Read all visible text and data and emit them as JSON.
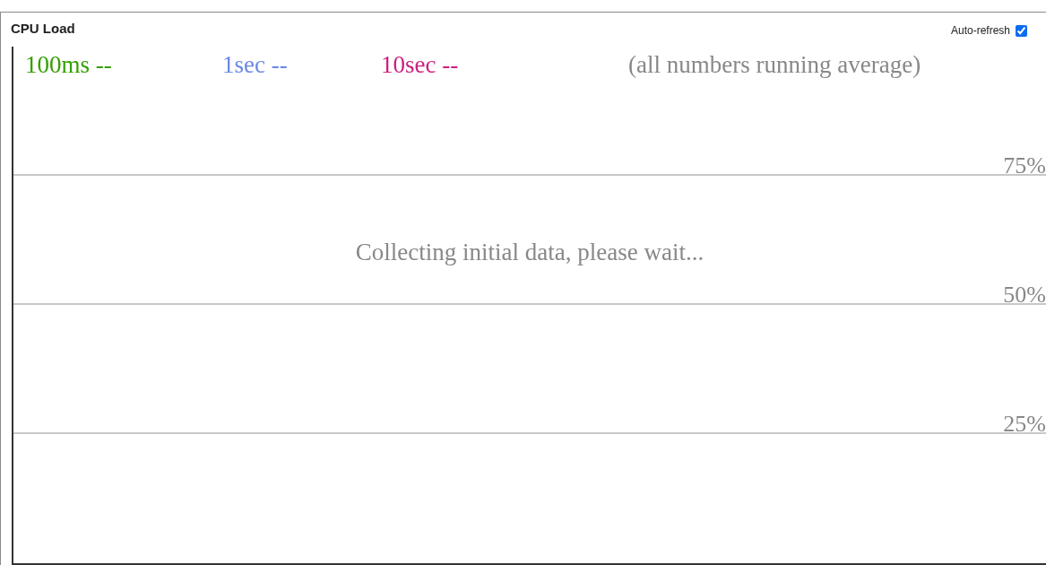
{
  "panel": {
    "title": "CPU Load",
    "auto_refresh": {
      "label": "Auto-refresh",
      "checked": true
    }
  },
  "legend": [
    {
      "label": "100ms --",
      "color": "#33a100"
    },
    {
      "label": "1sec --",
      "color": "#6b86e6"
    },
    {
      "label": "10sec --",
      "color": "#cc1f7f"
    }
  ],
  "note": "(all numbers running average)",
  "y_ticks": [
    "75%",
    "50%",
    "25%"
  ],
  "message": "Collecting initial data, please wait..."
}
